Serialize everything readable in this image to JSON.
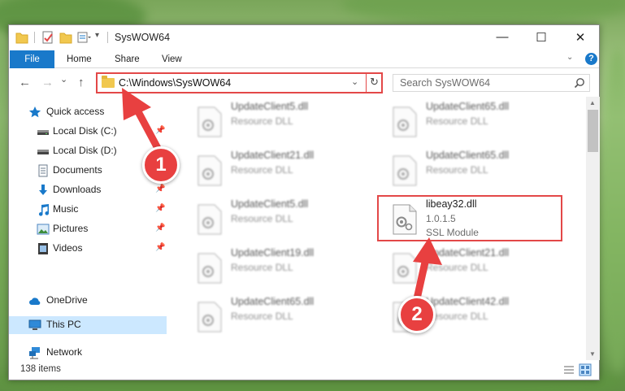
{
  "window": {
    "title": "SysWOW64",
    "controls": {
      "minimize": "—",
      "maximize": "☐",
      "close": "✕"
    }
  },
  "ribbon": {
    "tabs": [
      {
        "label": "File"
      },
      {
        "label": "Home"
      },
      {
        "label": "Share"
      },
      {
        "label": "View"
      }
    ],
    "help_label": "?"
  },
  "navigation": {
    "back": "←",
    "forward": "→",
    "recent": "⌄",
    "up": "↑",
    "address": "C:\\Windows\\SysWOW64",
    "dropdown": "⌄",
    "refresh": "↻",
    "search_placeholder": "Search SysWOW64"
  },
  "sidebar": {
    "items": [
      {
        "label": "Quick access",
        "icon": "star-icon"
      },
      {
        "label": "Local Disk (C:)",
        "icon": "drive-icon"
      },
      {
        "label": "Local Disk (D:)",
        "icon": "drive-icon"
      },
      {
        "label": "Documents",
        "icon": "documents-icon"
      },
      {
        "label": "Downloads",
        "icon": "download-icon"
      },
      {
        "label": "Music",
        "icon": "music-icon"
      },
      {
        "label": "Pictures",
        "icon": "pictures-icon"
      },
      {
        "label": "Videos",
        "icon": "videos-icon"
      },
      {
        "label": "OneDrive",
        "icon": "cloud-icon"
      },
      {
        "label": "This PC",
        "icon": "computer-icon"
      },
      {
        "label": "Network",
        "icon": "network-icon"
      }
    ],
    "pin": "📌"
  },
  "files": [
    {
      "name": "UpdateClient5.dll",
      "line2": "Resource DLL",
      "line3": "",
      "blurred": true
    },
    {
      "name": "UpdateClient65.dll",
      "line2": "Resource DLL",
      "line3": "",
      "blurred": true
    },
    {
      "name": "UpdateClient21.dll",
      "line2": "Resource DLL",
      "line3": "",
      "blurred": true
    },
    {
      "name": "UpdateClient65.dll",
      "line2": "Resource DLL",
      "line3": "",
      "blurred": true
    },
    {
      "name": "UpdateClient5.dll",
      "line2": "Resource DLL",
      "line3": "",
      "blurred": true
    },
    {
      "name": "libeay32.dll",
      "line2": "1.0.1.5",
      "line3": "SSL Module",
      "blurred": false
    },
    {
      "name": "UpdateClient19.dll",
      "line2": "Resource DLL",
      "line3": "",
      "blurred": true
    },
    {
      "name": "UpdateClient21.dll",
      "line2": "Resource DLL",
      "line3": "",
      "blurred": true
    },
    {
      "name": "UpdateClient65.dll",
      "line2": "Resource DLL",
      "line3": "",
      "blurred": true
    },
    {
      "name": "UpdateClient42.dll",
      "line2": "Resource DLL",
      "line3": "",
      "blurred": true
    }
  ],
  "status": {
    "item_count": "138 items"
  },
  "annotations": [
    {
      "label": "1"
    },
    {
      "label": "2"
    }
  ],
  "colors": {
    "accent": "#1979ca",
    "highlight": "#e34848",
    "selected": "#cce8ff"
  }
}
